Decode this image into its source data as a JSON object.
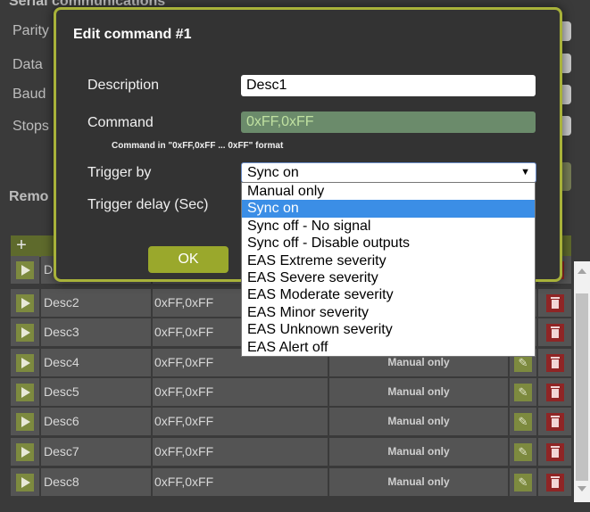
{
  "background": {
    "section_title": "Serial communications",
    "labels": [
      "Parity",
      "Data",
      "Baud",
      "Stops"
    ],
    "remote_title": "Remo",
    "first_row_desc": "D",
    "rows": [
      {
        "desc": "Desc2",
        "command": "0xFF,0xFF",
        "trigger": ""
      },
      {
        "desc": "Desc3",
        "command": "0xFF,0xFF",
        "trigger": ""
      },
      {
        "desc": "Desc4",
        "command": "0xFF,0xFF",
        "trigger": "Manual only"
      },
      {
        "desc": "Desc5",
        "command": "0xFF,0xFF",
        "trigger": "Manual only"
      },
      {
        "desc": "Desc6",
        "command": "0xFF,0xFF",
        "trigger": "Manual only"
      },
      {
        "desc": "Desc7",
        "command": "0xFF,0xFF",
        "trigger": "Manual only"
      },
      {
        "desc": "Desc8",
        "command": "0xFF,0xFF",
        "trigger": "Manual only"
      }
    ]
  },
  "modal": {
    "title": "Edit command #1",
    "description_label": "Description",
    "description_value": "Desc1",
    "command_label": "Command",
    "command_value": "0xFF,0xFF",
    "command_hint": "Command in \"0xFF,0xFF ... 0xFF\" format",
    "trigger_label": "Trigger by",
    "trigger_value": "Sync on",
    "delay_label": "Trigger delay (Sec)",
    "ok_label": "OK"
  },
  "dropdown": {
    "options": [
      "Manual only",
      "Sync on",
      "Sync off - No signal",
      "Sync off - Disable outputs",
      "EAS Extreme severity",
      "EAS Severe severity",
      "EAS Moderate severity",
      "EAS Minor severity",
      "EAS Unknown severity",
      "EAS Alert off"
    ],
    "selected": "Sync on"
  },
  "colors": {
    "accent": "#a8b23a",
    "ok_button": "#9aa82c",
    "selection": "#3b8ee6",
    "delete": "#8f2525"
  },
  "icons": [
    "play-icon",
    "add-icon",
    "edit-icon",
    "delete-icon",
    "dropdown-arrow-icon"
  ]
}
